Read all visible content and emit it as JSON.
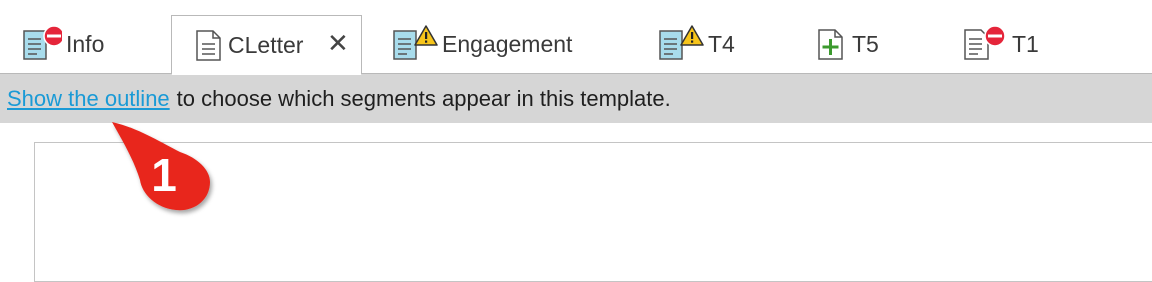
{
  "tabs": [
    {
      "label": "Info",
      "icon": "document-error-icon"
    },
    {
      "label": "CLetter",
      "icon": "document-icon",
      "active": true,
      "close": "✕"
    },
    {
      "label": "Engagement",
      "icon": "document-warning-icon"
    },
    {
      "label": "T4",
      "icon": "document-warning-icon"
    },
    {
      "label": "T5",
      "icon": "document-add-icon"
    },
    {
      "label": "T1",
      "icon": "document-error-icon"
    }
  ],
  "infobar": {
    "link_text": "Show the outline",
    "message": "to choose which segments appear in this template."
  },
  "callout": {
    "number": "1",
    "color": "#e8251b"
  },
  "colors": {
    "link": "#1a9ad6",
    "infobar_bg": "#d6d6d6",
    "doc_blue": "#a8dcec",
    "warning": "#f7c51b",
    "error": "#e5253a",
    "add_green": "#3c9a2e"
  }
}
